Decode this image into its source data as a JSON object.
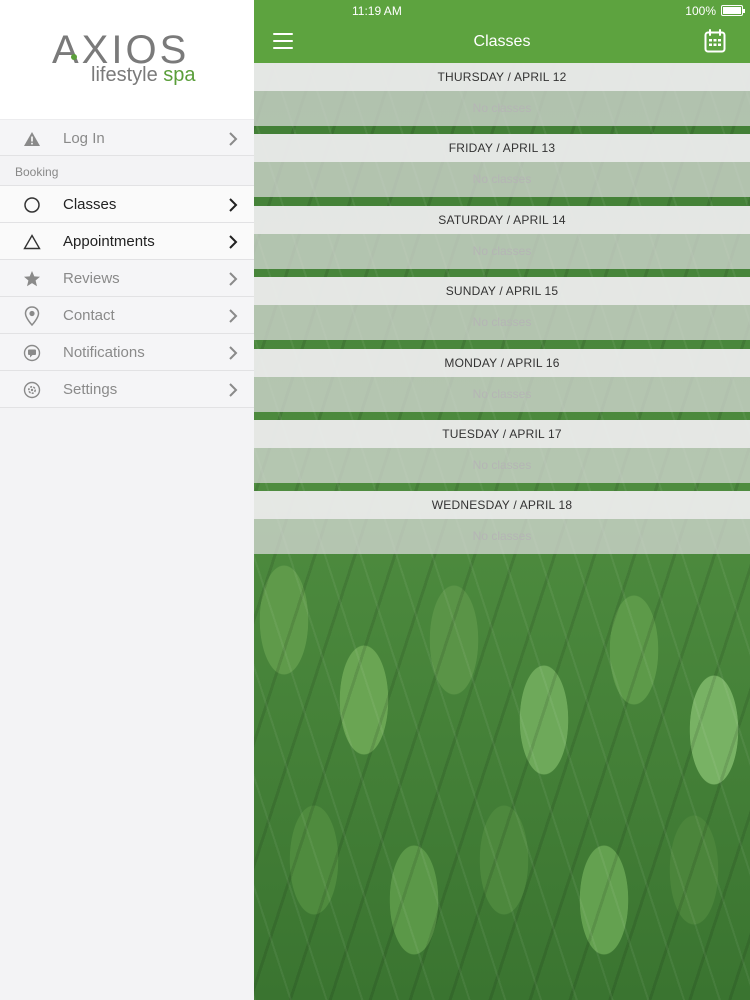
{
  "brand": {
    "logo_word": "AXIOS",
    "logo_sub_main": "lifestyle ",
    "logo_sub_accent": "spa",
    "accent_color": "#5da33f"
  },
  "sidebar": {
    "login": {
      "label": "Log In",
      "icon": "warning-icon"
    },
    "section_header": "Booking",
    "items": [
      {
        "label": "Classes",
        "icon": "circle-icon",
        "active": true
      },
      {
        "label": "Appointments",
        "icon": "triangle-icon",
        "active": true
      },
      {
        "label": "Reviews",
        "icon": "star-icon",
        "active": false
      },
      {
        "label": "Contact",
        "icon": "location-pin-icon",
        "active": false
      },
      {
        "label": "Notifications",
        "icon": "chat-bubble-icon",
        "active": false
      },
      {
        "label": "Settings",
        "icon": "gear-icon",
        "active": false
      }
    ]
  },
  "status_bar": {
    "time": "11:19 AM",
    "battery": "100%"
  },
  "nav": {
    "title": "Classes"
  },
  "days": [
    {
      "header": "THURSDAY / APRIL 12",
      "empty": "No classes"
    },
    {
      "header": "FRIDAY / APRIL 13",
      "empty": "No classes"
    },
    {
      "header": "SATURDAY / APRIL 14",
      "empty": "No classes"
    },
    {
      "header": "SUNDAY / APRIL 15",
      "empty": "No classes"
    },
    {
      "header": "MONDAY / APRIL 16",
      "empty": "No classes"
    },
    {
      "header": "TUESDAY / APRIL 17",
      "empty": "No classes"
    },
    {
      "header": "WEDNESDAY / APRIL 18",
      "empty": "No classes"
    }
  ]
}
